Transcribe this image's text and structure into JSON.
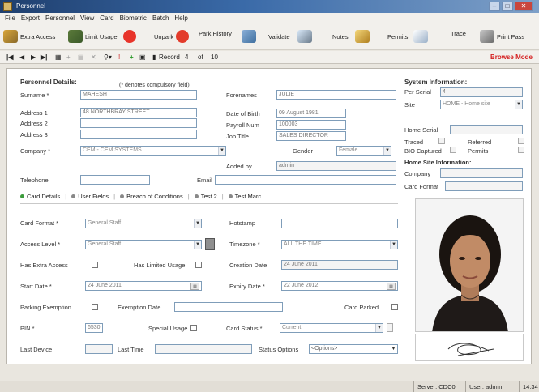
{
  "window": {
    "title": "Personnel"
  },
  "menu": [
    "File",
    "Export",
    "Personnel",
    "View",
    "Card",
    "Biometric",
    "Batch",
    "Help"
  ],
  "toolbar": {
    "extra_access": "Extra Access",
    "limit_usage": "Limit Usage",
    "unpark": "Unpark",
    "park_history": "Park History",
    "validate": "Validate",
    "notes": "Notes",
    "permits": "Permits",
    "trace": "Trace",
    "print_pass": "Print Pass"
  },
  "nav": {
    "record_label": "Record",
    "record_num": "4",
    "of_label": "of",
    "total": "10",
    "mode": "Browse Mode"
  },
  "personnel": {
    "header": "Personnel Details:",
    "compulsory_note": "(* denotes compulsory field)",
    "surname_label": "Surname *",
    "surname": "MAHESH",
    "forenames_label": "Forenames",
    "forenames": "JULIE",
    "address1_label": "Address 1",
    "address1": "48 NORTHBRAY STREET",
    "address2_label": "Address 2",
    "address2": "",
    "address3_label": "Address 3",
    "address3": "",
    "dob_label": "Date of Birth",
    "dob": "09 August 1981",
    "payroll_label": "Payroll Num",
    "payroll": "100003",
    "jobtitle_label": "Job Title",
    "jobtitle": "SALES DIRECTOR",
    "company_label": "Company *",
    "company": "CEM - CEM SYSTEMS",
    "gender_label": "Gender",
    "gender": "Female",
    "addedby_label": "Added by",
    "addedby": "admin",
    "telephone_label": "Telephone",
    "telephone": "",
    "email_label": "Email",
    "email": ""
  },
  "system": {
    "header": "System Information:",
    "perserial_label": "Per Serial",
    "perserial": "4",
    "site_label": "Site",
    "site": "HOME - Home site",
    "homeserial_label": "Home Serial",
    "homeserial": "",
    "traced_label": "Traced",
    "referred_label": "Referred",
    "bio_label": "BIO Captured",
    "permits_label": "Permits",
    "homesite_header": "Home Site Information:",
    "company_label": "Company",
    "company": "",
    "cardformat_label": "Card Format",
    "cardformat": ""
  },
  "tabs": [
    "Card Details",
    "User Fields",
    "Breach of Conditions",
    "Test 2",
    "Test Marc"
  ],
  "card": {
    "cardformat_label": "Card Format *",
    "cardformat": "General Staff",
    "hotstamp_label": "Hotstamp",
    "hotstamp": "",
    "accesslevel_label": "Access Level *",
    "accesslevel": "General Staff",
    "timezone_label": "Timezone *",
    "timezone": "ALL THE TIME",
    "extraaccess_label": "Has Extra Access",
    "limitedusage_label": "Has Limited Usage",
    "creationdate_label": "Creation Date",
    "creationdate": "24 June 2011",
    "startdate_label": "Start Date *",
    "startdate": "24 June 2011",
    "expirydate_label": "Expiry Date *",
    "expirydate": "22 June 2012",
    "parkingexempt_label": "Parking Exemption",
    "exemptiondate_label": "Exemption Date",
    "exemptiondate": "",
    "cardparked_label": "Card Parked",
    "pin_label": "PIN *",
    "pin": "6530",
    "specialusage_label": "Special Usage",
    "cardstatus_label": "Card Status *",
    "cardstatus": "Current",
    "lastdevice_label": "Last Device",
    "lastdevice": "",
    "lasttime_label": "Last Time",
    "lasttime": "",
    "statusoptions_label": "Status Options",
    "statusoptions": "<Options>"
  },
  "status": {
    "server": "Server: CDC0",
    "user": "User: admin",
    "time": "14:34"
  }
}
